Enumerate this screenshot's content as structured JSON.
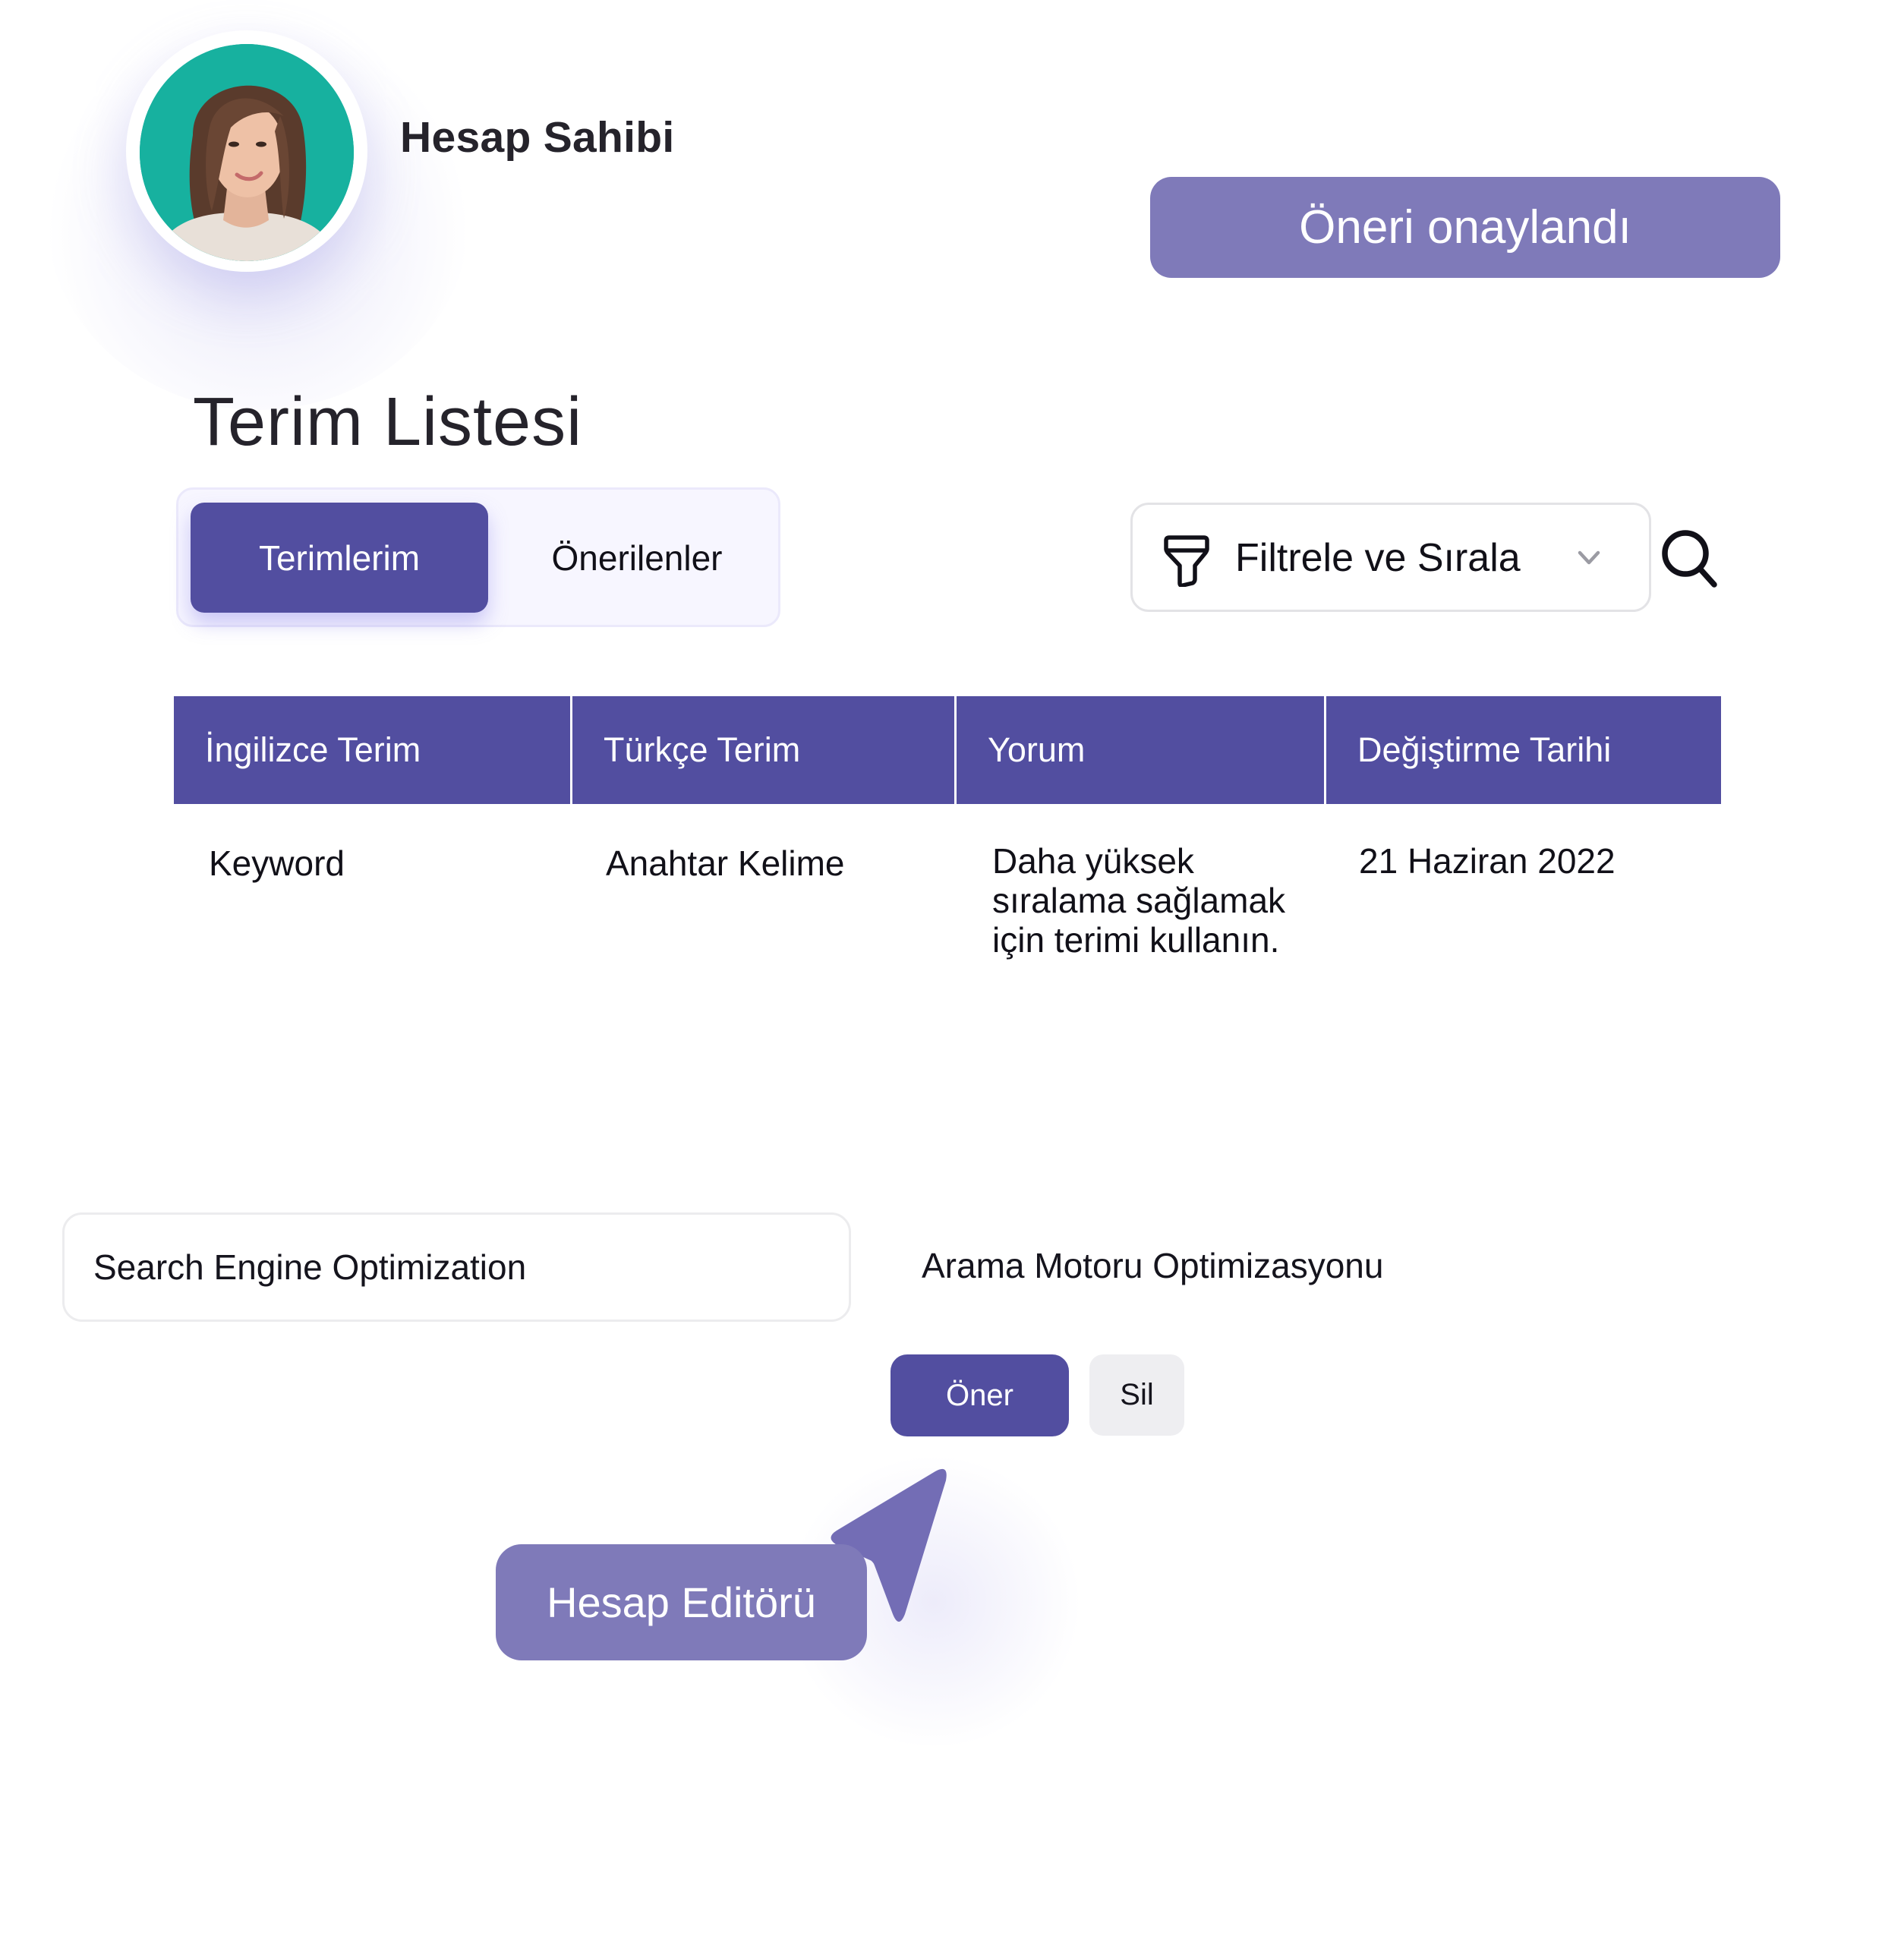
{
  "profile": {
    "name": "Hesap Sahibi",
    "avatar_bg": "#17b19f",
    "avatar_icon": "user-photo"
  },
  "notification": {
    "label": "Öneri onaylandı",
    "color": "#7f7ab9"
  },
  "page": {
    "title": "Terim Listesi"
  },
  "tabs": [
    {
      "label": "Terimlerim",
      "active": true
    },
    {
      "label": "Önerilenler",
      "active": false
    }
  ],
  "toolbar": {
    "filter_label": "Filtrele ve Sırala",
    "filter_icon": "funnel-icon",
    "dropdown_icon": "chevron-down-icon",
    "search_icon": "search-icon"
  },
  "table": {
    "header_color": "#524ea0",
    "columns": [
      "İngilizce Terim",
      "Türkçe Terim",
      "Yorum",
      "Değiştirme Tarihi"
    ],
    "rows": [
      {
        "english": "Keyword",
        "turkish": "Anahtar Kelime",
        "comment": "Daha yüksek sıralama sağlamak için terimi kullanın.",
        "date": "21 Haziran 2022"
      }
    ]
  },
  "editor": {
    "term_value": "Search Engine Optimization",
    "translation": "Arama Motoru Optimizasyonu",
    "suggest_label": "Öner",
    "delete_label": "Sil",
    "role_label": "Hesap Editörü",
    "cursor_icon": "pointer-arrow-icon"
  },
  "colors": {
    "primary": "#524ea0",
    "accent_soft": "#7f7ab9",
    "cursor": "#736db5"
  }
}
